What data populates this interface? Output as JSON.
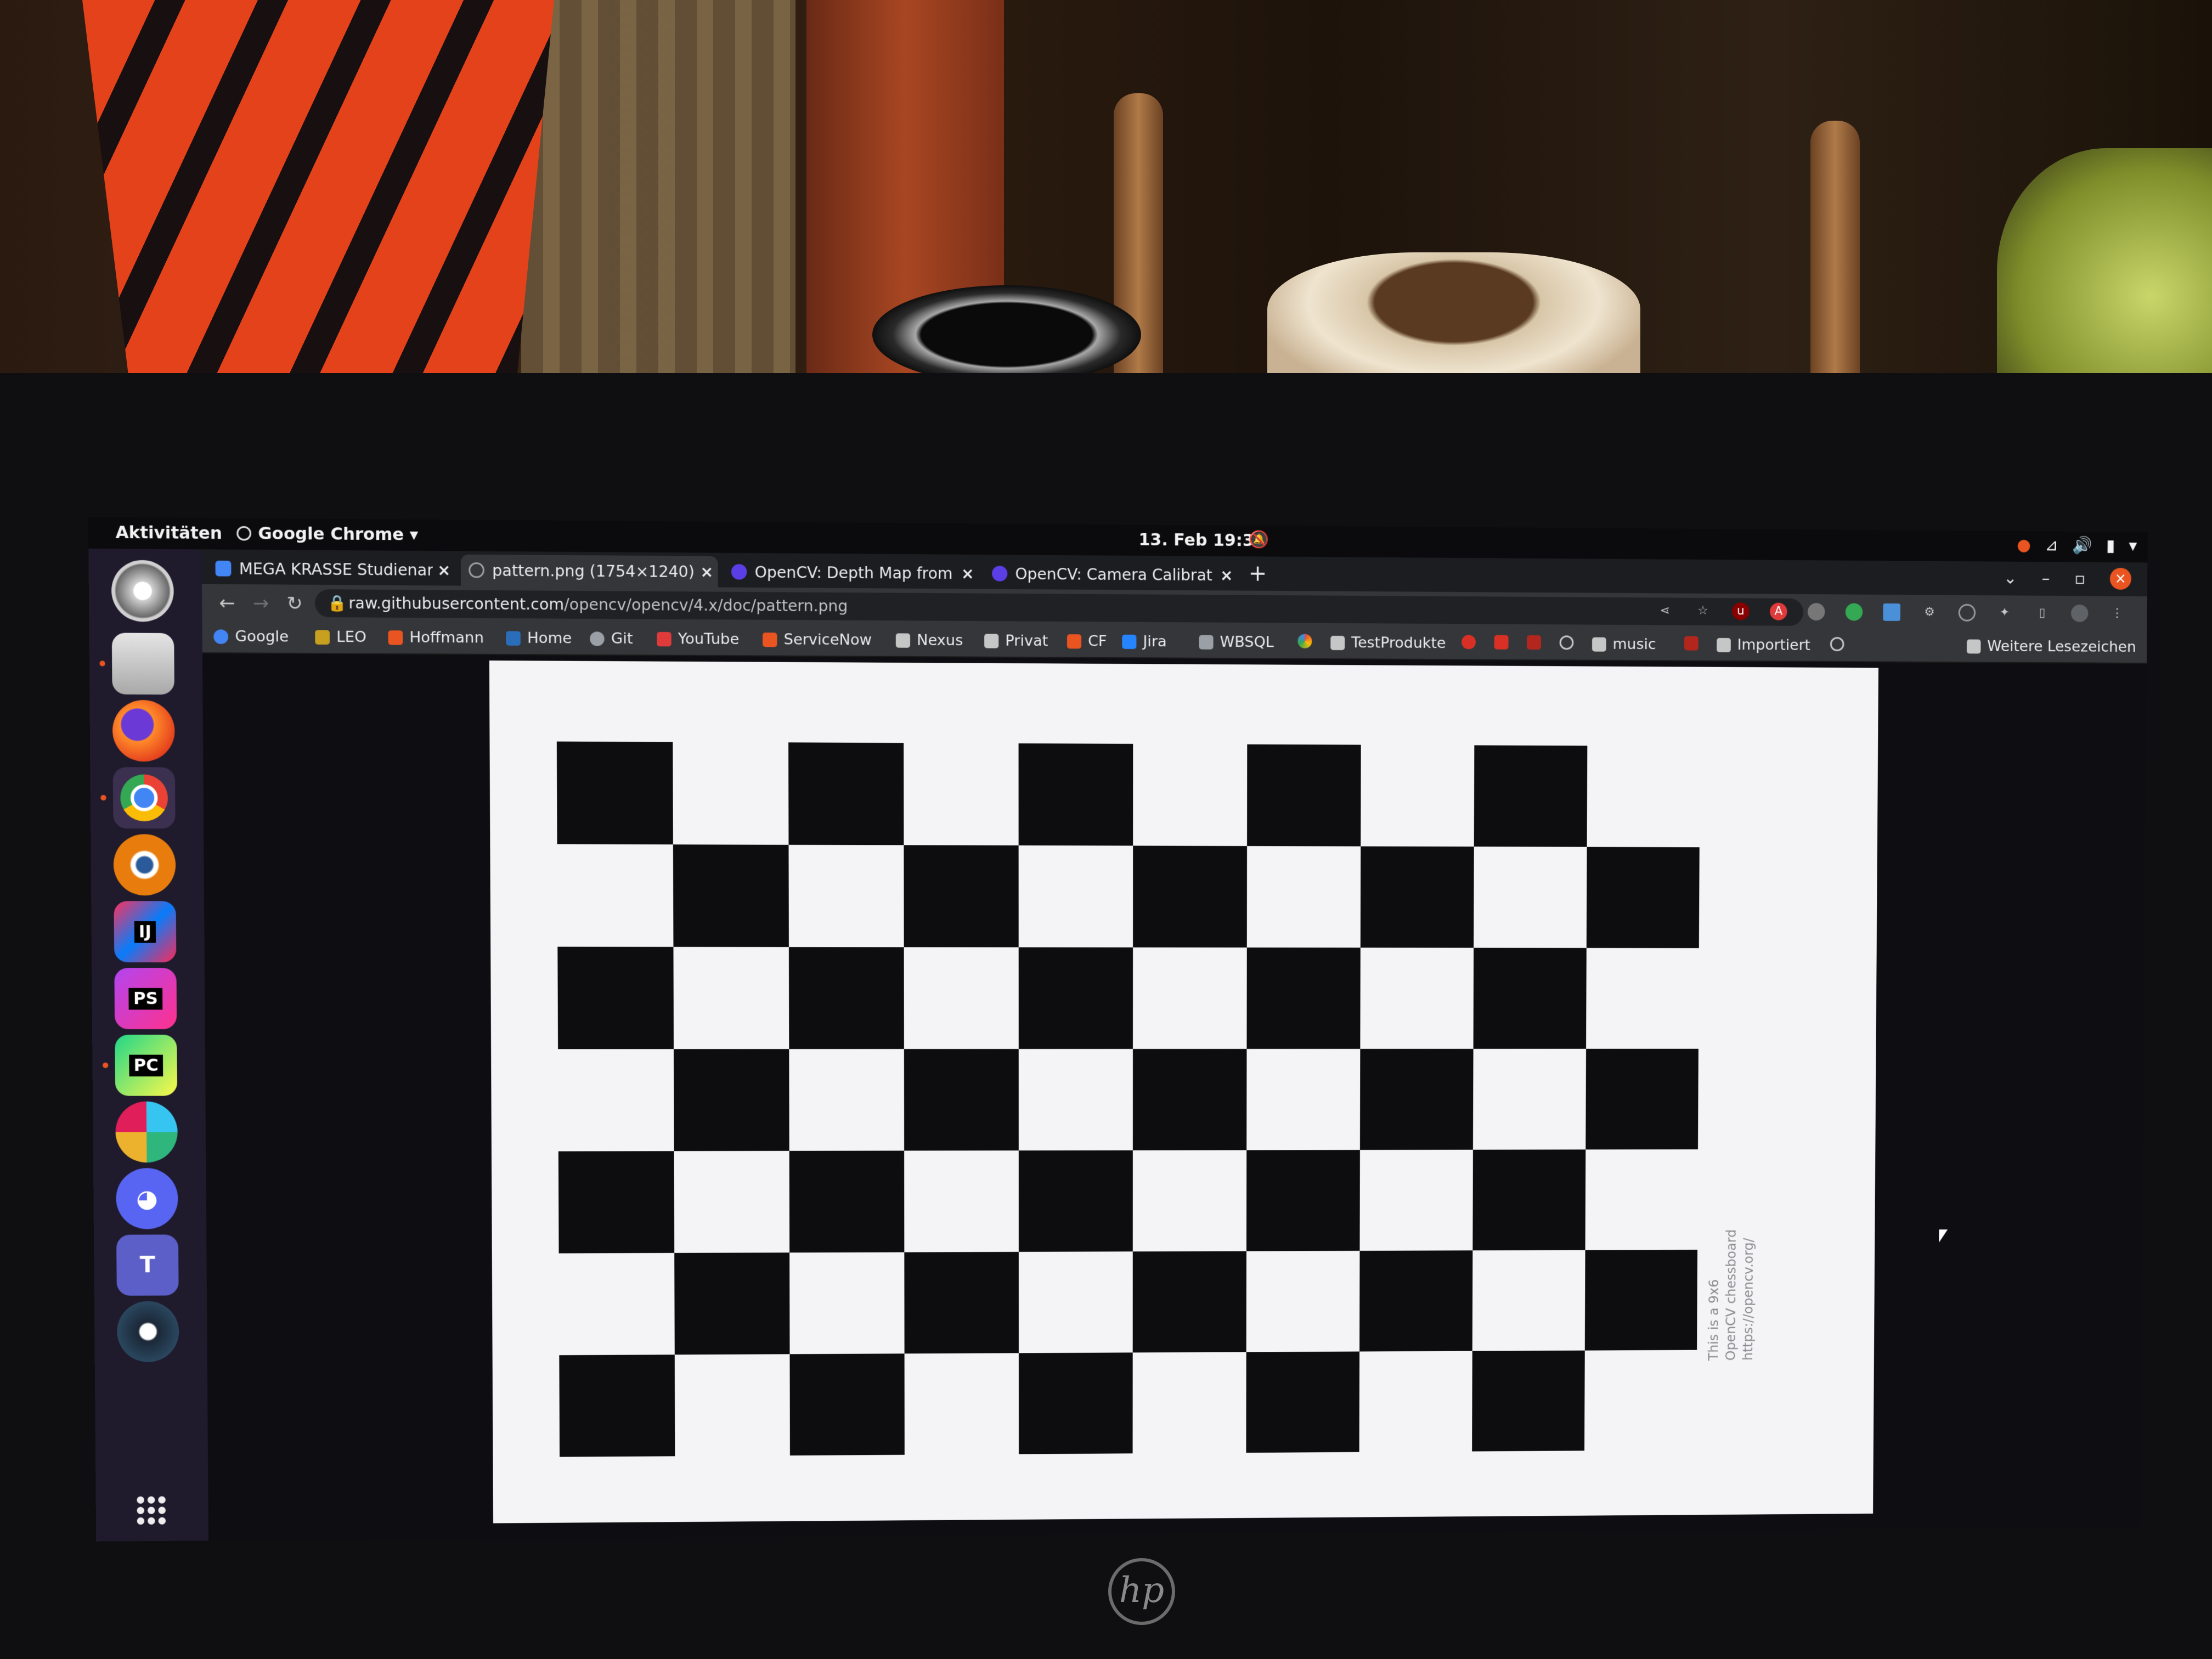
{
  "topbar": {
    "activities": "Aktivitäten",
    "app_menu": "Google Chrome ▾",
    "clock": "13. Feb  19:39"
  },
  "tabs": [
    {
      "label": "MEGA KRASSE Studienarbeit",
      "close": "×",
      "icon_color": "#4285f4"
    },
    {
      "label": "pattern.png (1754×1240)",
      "close": "×",
      "icon_color": "#9aa0a6"
    },
    {
      "label": "OpenCV: Depth Map from",
      "close": "×",
      "icon_color": "#5c3ee6"
    },
    {
      "label": "OpenCV: Camera Calibrat",
      "close": "×",
      "icon_color": "#5c3ee6"
    }
  ],
  "new_tab": "+",
  "window_controls": {
    "dropdown": "⌄",
    "minimize": "–",
    "maximize": "▫",
    "close": "×"
  },
  "toolbar": {
    "back": "←",
    "forward": "→",
    "reload": "↻",
    "url_host": "raw.githubusercontent.com",
    "url_path": "/opencv/opencv/4.x/doc/pattern.png"
  },
  "bookmarks": [
    {
      "label": "Google",
      "icon_color": "#4285f4"
    },
    {
      "label": "LEO",
      "icon_color": "#c8a020"
    },
    {
      "label": "Hoffmann",
      "icon_color": "#e95420"
    },
    {
      "label": "Home",
      "icon_color": "#2a6ebb"
    },
    {
      "label": "Git",
      "icon_color": "#9aa0a6"
    },
    {
      "label": "YouTube",
      "icon_color": "#e03a3a"
    },
    {
      "label": "ServiceNow",
      "icon_color": "#e95420"
    },
    {
      "label": "Nexus",
      "icon_color": "#c4c7c5"
    },
    {
      "label": "Privat",
      "icon_color": "#c4c7c5"
    },
    {
      "label": "CF",
      "icon_color": "#e95420"
    },
    {
      "label": "Jira",
      "icon_color": "#2684ff"
    },
    {
      "label": "WBSQL",
      "icon_color": "#9aa0a6"
    },
    {
      "label": "TestProdukte",
      "icon_color": "#c4c7c5"
    },
    {
      "label": "music",
      "icon_color": "#c4c7c5"
    },
    {
      "label": "Importiert",
      "icon_color": "#c4c7c5"
    }
  ],
  "bookmarks_more": "Weitere Lesezeichen",
  "dock": [
    {
      "name": "settings",
      "color": "#d0d0d0"
    },
    {
      "name": "files",
      "color": "#b8b8b8"
    },
    {
      "name": "firefox",
      "color": "#e8742a"
    },
    {
      "name": "chrome",
      "color": "#34a853"
    },
    {
      "name": "blender",
      "color": "#e87d0d"
    },
    {
      "name": "intellij",
      "label": "IJ",
      "color": "#fe315d"
    },
    {
      "name": "phpstorm",
      "label": "PS",
      "color": "#b345f1"
    },
    {
      "name": "pycharm",
      "label": "PC",
      "color": "#21d789"
    },
    {
      "name": "slack",
      "color": "#e6e6e6"
    },
    {
      "name": "discord",
      "color": "#5865f2"
    },
    {
      "name": "teams",
      "label": "T",
      "color": "#5b5fc7"
    },
    {
      "name": "steam",
      "color": "#1b2838"
    }
  ],
  "image_caption": [
    "This is a 9x6",
    "OpenCV chessboard",
    "https://opencv.org/"
  ],
  "bezel": {
    "hp_logo": "hp"
  }
}
